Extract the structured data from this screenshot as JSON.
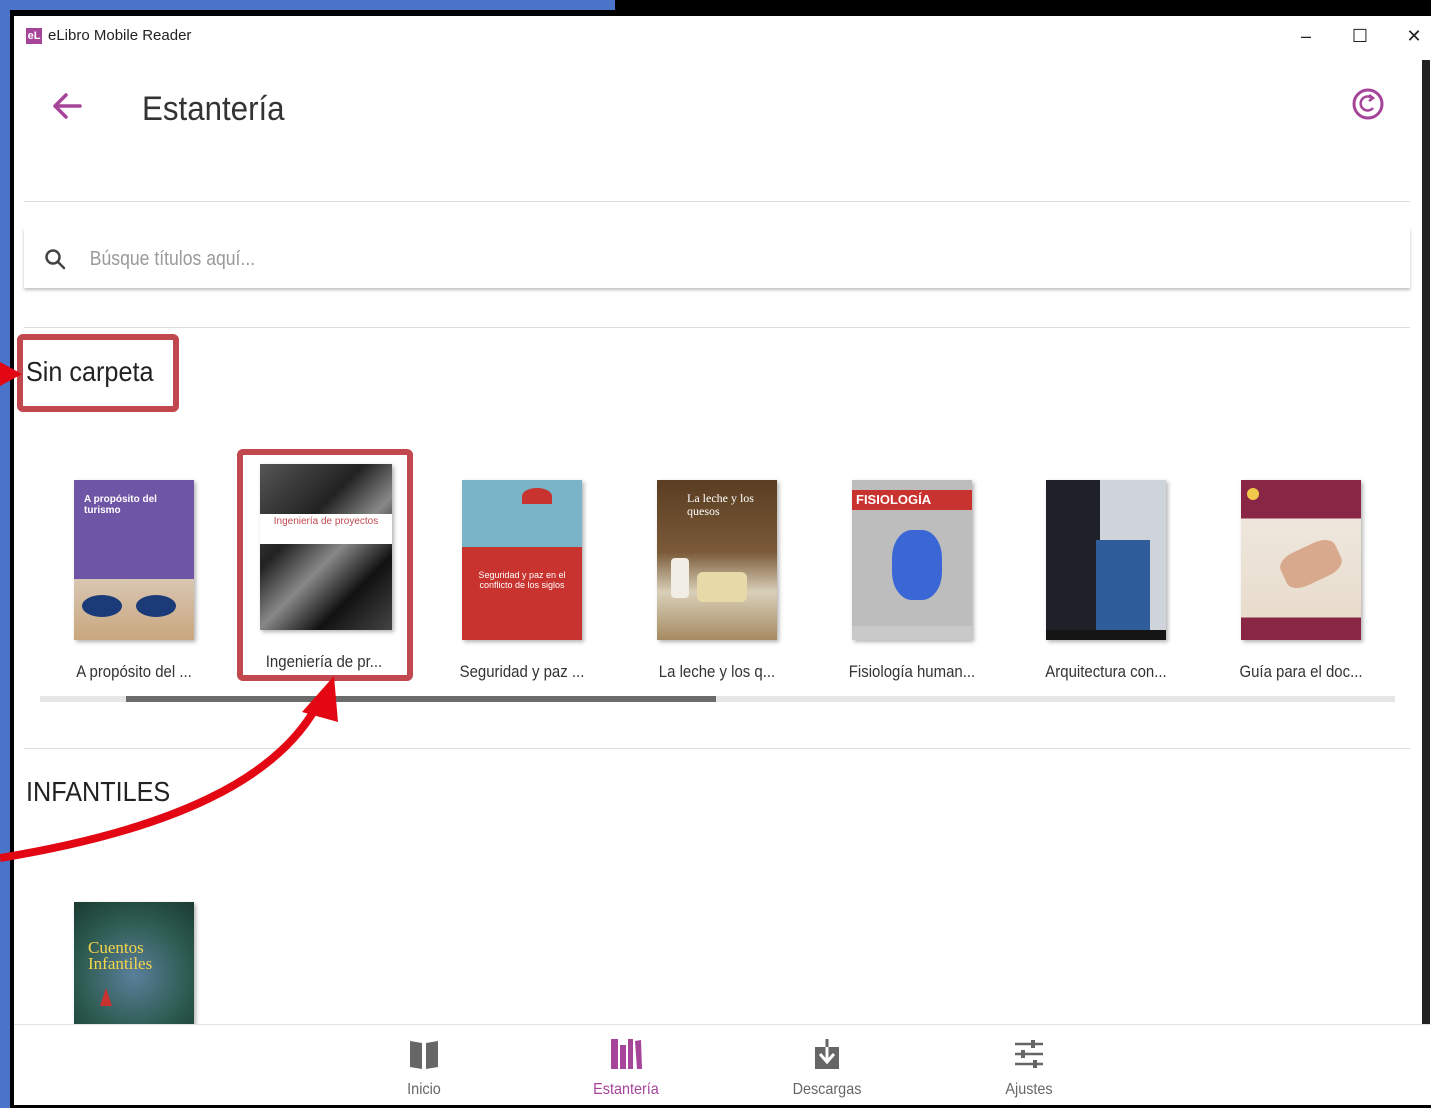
{
  "app": {
    "title": "eLibro Mobile Reader",
    "logo_text": "eL"
  },
  "window_controls": {
    "minimize": "–",
    "maximize": "☐",
    "close": "✕"
  },
  "header": {
    "title": "Estantería"
  },
  "search": {
    "placeholder": "Búsque títulos aquí..."
  },
  "sections": [
    {
      "title": "Sin carpeta",
      "books": [
        {
          "title": "A propósito del ...",
          "cover_text": "A propósito del turismo",
          "cover_color": "#6f55a6"
        },
        {
          "title": "Ingeniería de pr...",
          "cover_text": "Ingeniería de proyectos",
          "cover_color": "#2a2a2a"
        },
        {
          "title": "Seguridad y paz ...",
          "cover_text": "Seguridad y paz en el conflicto de los siglos",
          "cover_color": "#c8322f"
        },
        {
          "title": "La leche y los q...",
          "cover_text": "La leche y los quesos",
          "cover_color": "#6b4a2a"
        },
        {
          "title": "Fisiología human...",
          "cover_text": "FISIOLOGÍA",
          "cover_color": "#8c8c8c"
        },
        {
          "title": "Arquitectura con...",
          "cover_text": "",
          "cover_color": "#2b2f3a"
        },
        {
          "title": "Guía para el doc...",
          "cover_text": "",
          "cover_color": "#8a2645"
        }
      ]
    },
    {
      "title": "INFANTILES",
      "books": [
        {
          "title": "",
          "cover_text": "Cuentos Infantiles",
          "cover_color": "#2c5a4e"
        }
      ]
    }
  ],
  "bottom_nav": [
    {
      "label": "Inicio",
      "icon": "book-open-icon",
      "active": false
    },
    {
      "label": "Estantería",
      "icon": "bookshelf-icon",
      "active": true
    },
    {
      "label": "Descargas",
      "icon": "download-icon",
      "active": false
    },
    {
      "label": "Ajustes",
      "icon": "sliders-icon",
      "active": false
    }
  ],
  "colors": {
    "accent": "#a6449a",
    "annotation_red": "#e30613",
    "highlight_box": "#c0484e",
    "desktop_blue": "#4b73c9"
  }
}
